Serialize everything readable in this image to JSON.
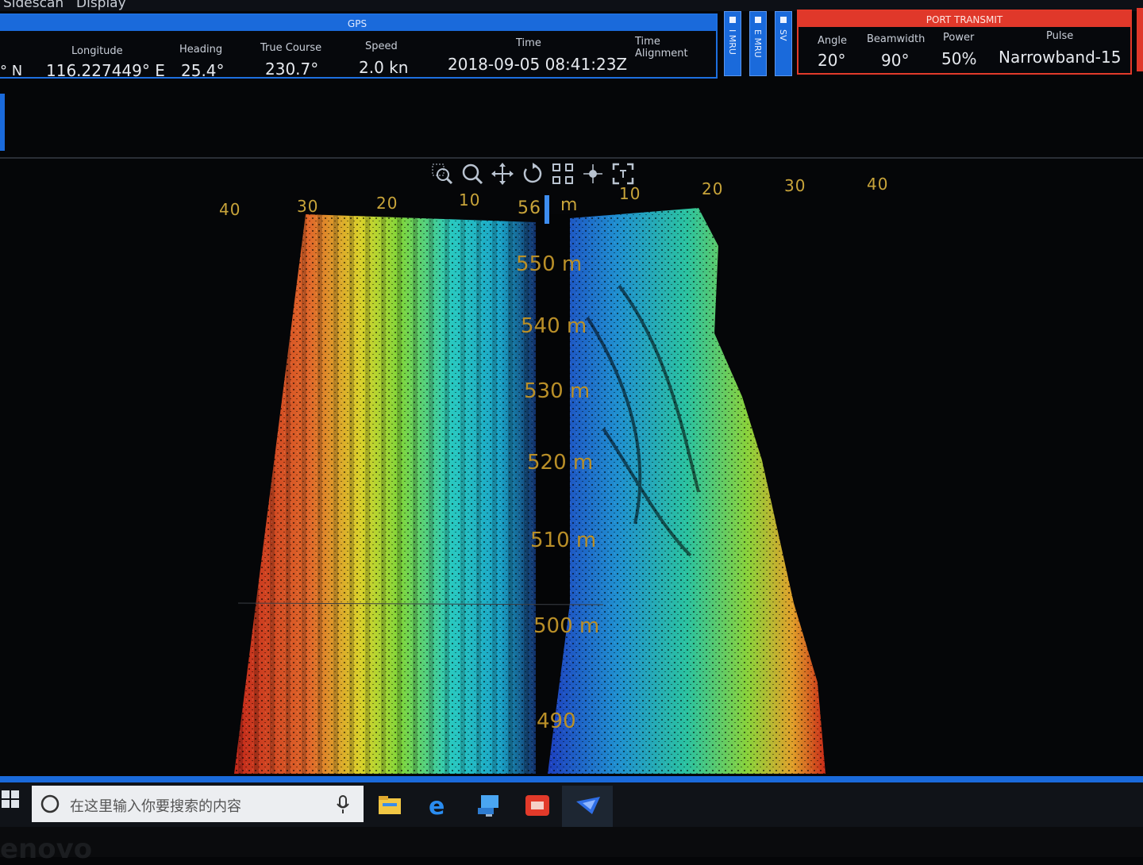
{
  "menu": {
    "item1": "Sidescan",
    "item2": "Display"
  },
  "gps": {
    "header": "GPS",
    "latitude_value": "° N",
    "longitude_label": "Longitude",
    "longitude_value": "116.227449° E",
    "heading_label": "Heading",
    "heading_value": "25.4°",
    "course_label": "True Course",
    "course_value": "230.7°",
    "speed_label": "Speed",
    "speed_value": "2.0 kn",
    "time_label": "Time",
    "time_value": "2018-09-05 08:41:23Z",
    "time_alignment_label": "Time Alignment"
  },
  "status_tabs": [
    "I MRU",
    "E MRU",
    "SV"
  ],
  "port_transmit": {
    "header": "PORT TRANSMIT",
    "angle_label": "Angle",
    "angle_value": "20°",
    "beamwidth_label": "Beamwidth",
    "beamwidth_value": "90°",
    "power_label": "Power",
    "power_value": "50%",
    "pulse_label": "Pulse",
    "pulse_value": "Narrowband-15"
  },
  "toolbar_icons": [
    "zoom-region-icon",
    "zoom-icon",
    "pan-icon",
    "rotate-icon",
    "fit-extents-icon",
    "center-point-icon",
    "frame-icon"
  ],
  "sonar": {
    "x_ticks_left": [
      "40",
      "30",
      "20",
      "10"
    ],
    "x_ticks_right": [
      "10",
      "20",
      "30",
      "40"
    ],
    "current_range_value": "56",
    "current_range_unit": "m",
    "range_rings": [
      "550 m",
      "540 m",
      "530 m",
      "520 m",
      "510 m",
      "500 m",
      "490"
    ]
  },
  "taskbar": {
    "search_placeholder": "在这里输入你要搜索的内容"
  },
  "bezel_brand": "enovo",
  "colors": {
    "accent_blue": "#1a6adb",
    "accent_red": "#e0382a",
    "range_text": "#b98f28"
  }
}
